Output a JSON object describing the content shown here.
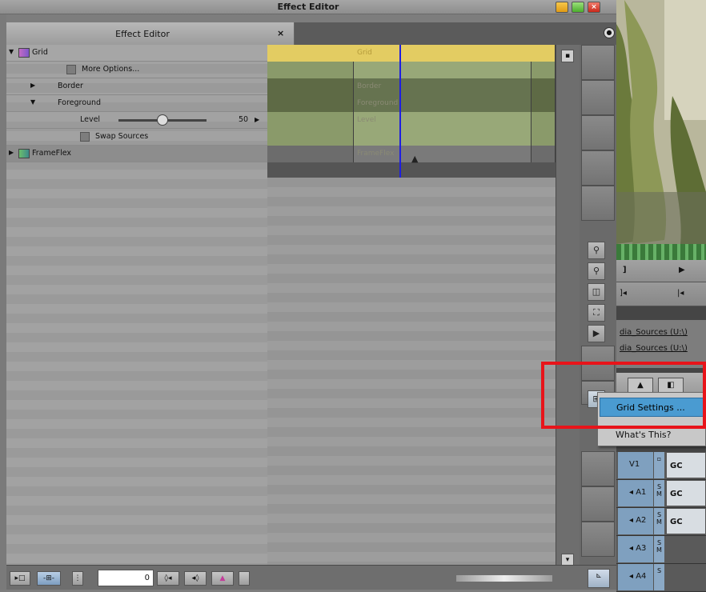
{
  "window": {
    "title": "Effect Editor"
  },
  "tab": {
    "label": "Effect Editor",
    "close": "×"
  },
  "effect_tree": [
    {
      "label": "Grid",
      "level": 0,
      "expanded": true
    },
    {
      "label": "More Options...",
      "level": 1,
      "checkbox": true
    },
    {
      "label": "Border",
      "level": 1,
      "expanded": false
    },
    {
      "label": "Foreground",
      "level": 1,
      "expanded": true
    },
    {
      "label": "Level",
      "level": 2,
      "value": "50",
      "slider_fraction": 0.5
    },
    {
      "label": "Swap Sources",
      "level": 2,
      "checkbox": true
    },
    {
      "label": "FrameFlex",
      "level": 0,
      "expanded": false
    }
  ],
  "timeline_rows": [
    "Grid",
    "",
    "Border",
    "Foreground",
    "Level",
    "",
    "FrameFlex"
  ],
  "bottom_bar": {
    "position_value": "0"
  },
  "context_menu": {
    "highlighted": "Grid Settings ...",
    "second": "What's This?"
  },
  "sources": [
    "dia_Sources (U:\\)",
    "dia_Sources (U:\\)"
  ],
  "tracks": [
    {
      "label": "V1",
      "clip": "GC"
    },
    {
      "label": "◂ A1",
      "clip": "GC"
    },
    {
      "label": "◂ A2",
      "clip": "GC"
    },
    {
      "label": "◂ A3",
      "clip": ""
    },
    {
      "label": "◂ A4",
      "clip": ""
    }
  ],
  "colors": {
    "highlight": "#4a9bd1",
    "annotation": "#e8141a",
    "playhead": "#1e1ee0",
    "keyframe_bar": "#e3cc62"
  }
}
